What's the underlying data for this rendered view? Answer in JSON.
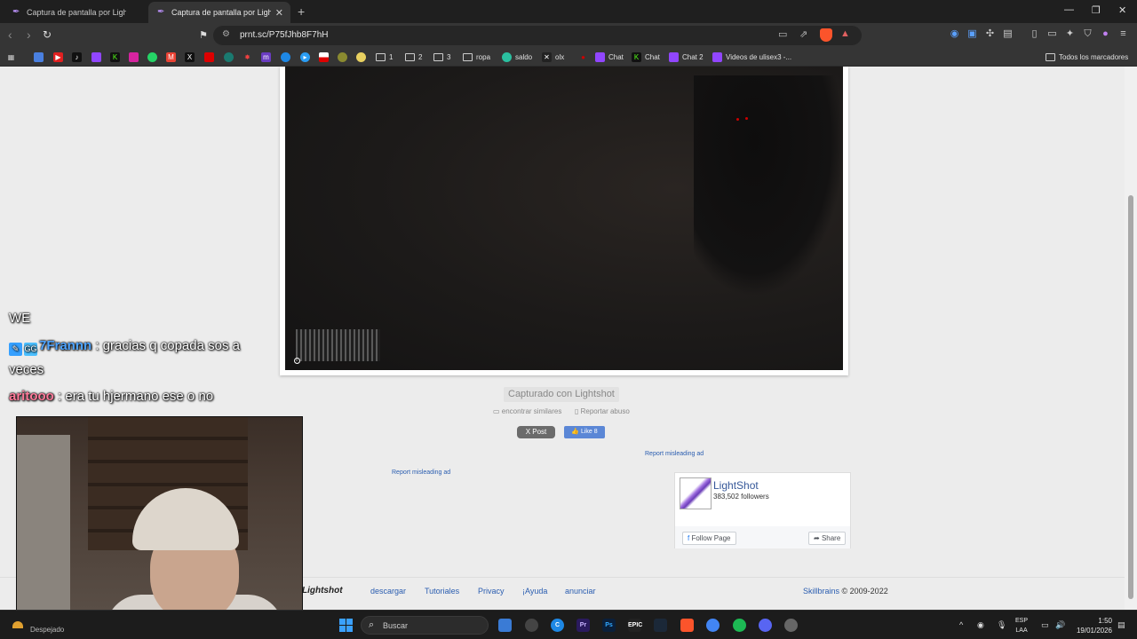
{
  "tabs": [
    {
      "title": "Captura de pantalla por Lightshot"
    },
    {
      "title": "Captura de pantalla por Lightshot"
    }
  ],
  "address": {
    "url": "prnt.sc/P75fJhb8F7hH"
  },
  "bookmarks": [
    {
      "label": "1"
    },
    {
      "label": "2"
    },
    {
      "label": "3"
    },
    {
      "label": "ropa"
    },
    {
      "label": "saldo"
    },
    {
      "label": "olx"
    },
    {
      "label": "Chat"
    },
    {
      "label": "Chat"
    },
    {
      "label": "Chat 2"
    },
    {
      "label": "Videos de ulisex3 -..."
    },
    {
      "label": "Todos los marcadores"
    }
  ],
  "page": {
    "captured_label": "Capturado con Lightshot",
    "find_similar": "encontrar similares",
    "report_abuse": "Reportar abuso",
    "post_label": "Post",
    "like_label": "Like 8",
    "report_ad": "Report misleading ad",
    "fb": {
      "name": "LightShot",
      "followers": "383,502 followers",
      "follow": "Follow Page",
      "share": "Share"
    },
    "footer": {
      "logo": "Lightshot",
      "links": [
        "descargar",
        "Tutoriales",
        "Privacy",
        "¡Ayuda",
        "anunciar"
      ],
      "brand": "Skillbrains",
      "copyright": "© 2009-2022"
    }
  },
  "chat": [
    {
      "user": "",
      "text": "WE"
    },
    {
      "user": "7Frannn",
      "text": ": gracias q copada sos a"
    },
    {
      "user": "",
      "text": "veces"
    },
    {
      "user": "aritooo",
      "text": ": era tu hjermano ese o no"
    }
  ],
  "taskbar": {
    "weather": "Despejado",
    "search": "Buscar",
    "lang_top": "ESP",
    "lang_bottom": "LAA",
    "time": "1:50",
    "date": "19/01/2026"
  }
}
